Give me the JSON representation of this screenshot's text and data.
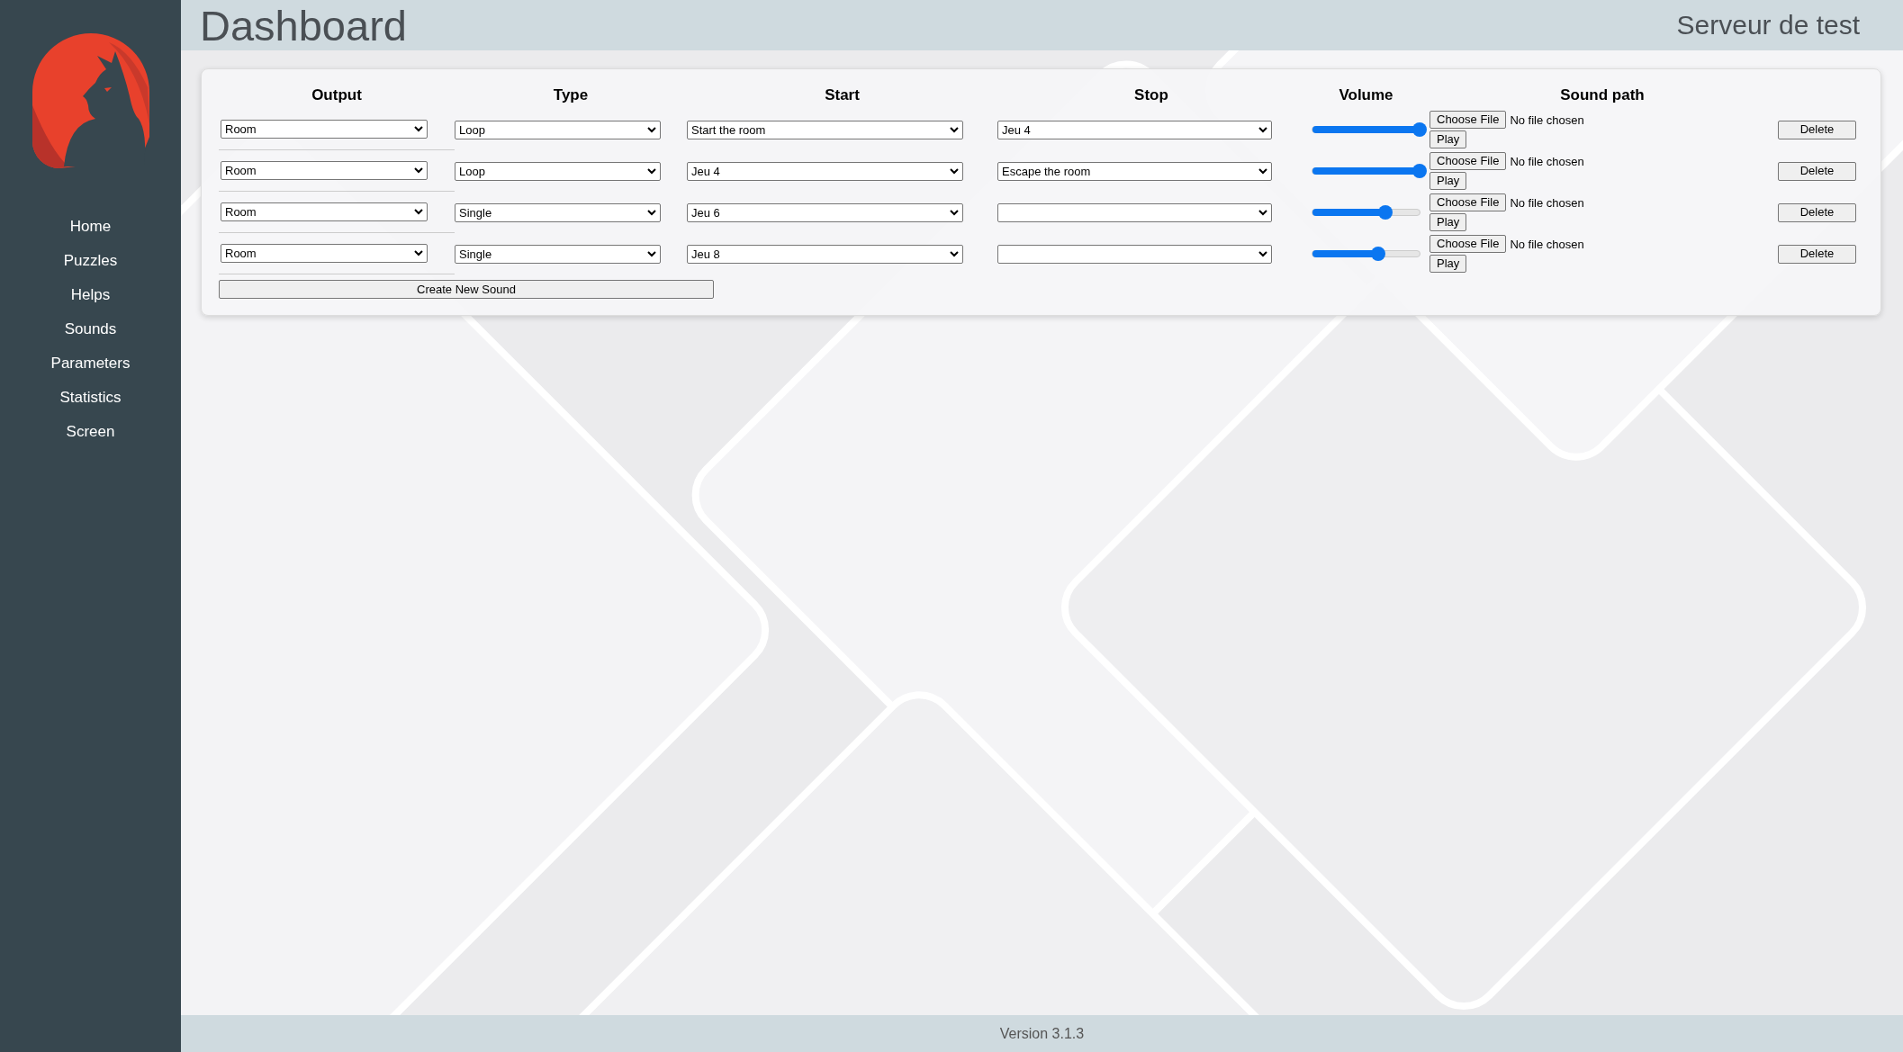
{
  "sidebar": {
    "items": [
      {
        "label": "Home"
      },
      {
        "label": "Puzzles"
      },
      {
        "label": "Helps"
      },
      {
        "label": "Sounds"
      },
      {
        "label": "Parameters"
      },
      {
        "label": "Statistics"
      },
      {
        "label": "Screen"
      }
    ]
  },
  "header": {
    "title": "Dashboard",
    "server_name": "Serveur de test"
  },
  "table": {
    "columns": [
      "Output",
      "Type",
      "Start",
      "Stop",
      "Volume",
      "Sound path"
    ],
    "rows": [
      {
        "output": "Room",
        "type": "Loop",
        "start": "Start the room",
        "stop": "Jeu 4",
        "level": 1,
        "choose_button": "Choose File",
        "file_status": "No file chosen",
        "play_button": "Play",
        "delete_button": "Delete"
      },
      {
        "output": "Room",
        "type": "Loop",
        "start": "Jeu 4",
        "stop": "Escape the room",
        "level": 1,
        "choose_button": "Choose File",
        "file_status": "No file chosen",
        "play_button": "Play",
        "delete_button": "Delete"
      },
      {
        "output": "Room",
        "type": "Single",
        "start": "Jeu 6",
        "level": 0.68,
        "choose_button": "Choose File",
        "file_status": "No file chosen",
        "play_button": "Play",
        "delete_button": "Delete"
      },
      {
        "output": "Room",
        "type": "Single",
        "start": "Jeu 8",
        "level": 0.61,
        "choose_button": "Choose File",
        "file_status": "No file chosen",
        "play_button": "Play",
        "delete_button": "Delete"
      }
    ],
    "create_button": "Create New Sound"
  },
  "footer": {
    "version": "Version 3.1.3"
  }
}
